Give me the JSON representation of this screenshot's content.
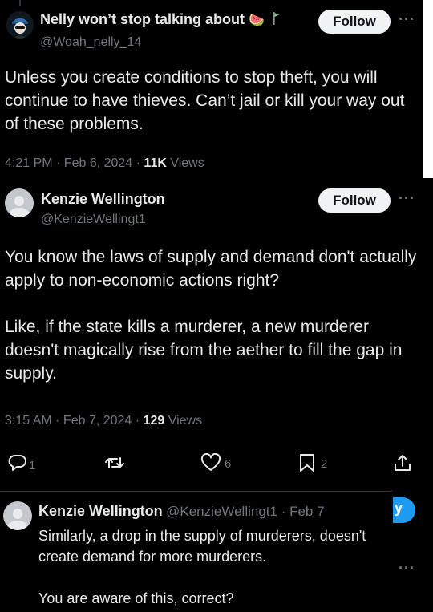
{
  "tweet1": {
    "name": "Nelly won’t stop talking about",
    "name_emoji": "🍉",
    "handle": "@Woah_nelly_14",
    "follow_label": "Follow",
    "more_label": "···",
    "text": "Unless you create conditions to stop theft, you will continue to have thieves. Can’t jail or kill your way out of these problems.",
    "time": "4:21 PM · Feb 6, 2024 · ",
    "views_count": "11K",
    "views_label": " Views"
  },
  "tweet2": {
    "name": "Kenzie Wellington",
    "handle": "@KenzieWellingt1",
    "follow_label": "Follow",
    "more_label": "···",
    "text_p1": "You know the laws of supply and demand don't actually apply to non-economic actions right?",
    "text_p2": "Like, if the state kills a murderer, a new murderer doesn't magically rise from the aether to fill the gap in supply.",
    "time": "3:15 AM · Feb 7, 2024 · ",
    "views_count": "129",
    "views_label": " Views",
    "actions": {
      "replies": "1",
      "retweets": "",
      "likes": "6",
      "bookmarks": "2"
    }
  },
  "reply": {
    "name": "Kenzie Wellington",
    "handle_time": "@KenzieWellingt1 · Feb 7",
    "text_p1": "Similarly, a drop in the supply of murderers, doesn't create demand for more murderers.",
    "text_p2": "You are aware of this, correct?",
    "partial_button_label": "y",
    "more_label": "···"
  },
  "colors": {
    "background": "#000000",
    "text": "#e7e9ea",
    "muted": "#71767b",
    "accent": "#1d9bf0",
    "follow_bg": "#eff3f4"
  }
}
